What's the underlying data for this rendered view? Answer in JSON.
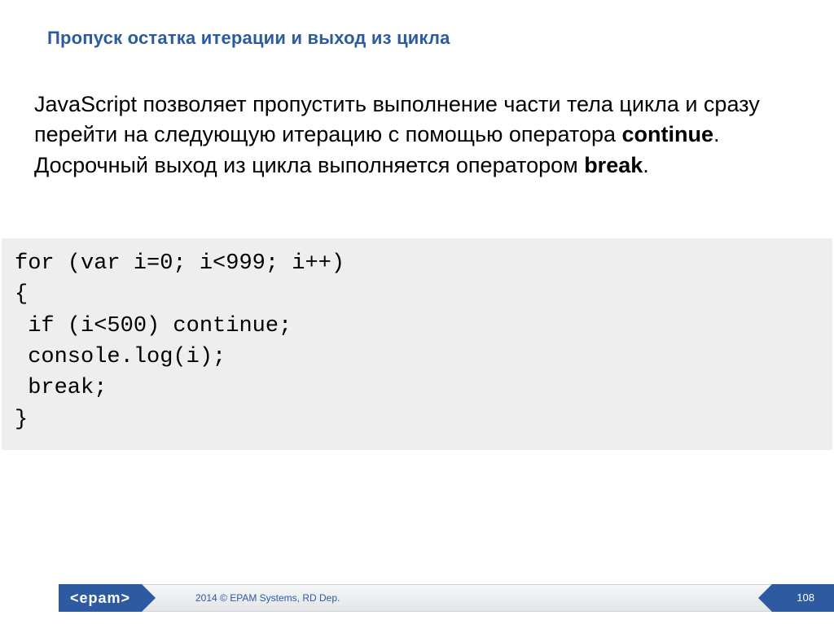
{
  "heading": "Пропуск остатка итерации и выход из цикла",
  "body": {
    "part1": "JavaScript позволяет пропустить выполнение части тела цикла и сразу перейти на следующую итерацию с помощью оператора ",
    "bold1": "continue",
    "part2": ". Досрочный выход из цикла выполняется оператором ",
    "bold2": "break",
    "part3": "."
  },
  "code": "for (var i=0; i<999; i++)\n{\n if (i<500) continue;\n console.log(i);\n break;\n}",
  "footer": {
    "logo": "<epam>",
    "copyright": "2014 © EPAM Systems, RD Dep.",
    "page": "108"
  }
}
